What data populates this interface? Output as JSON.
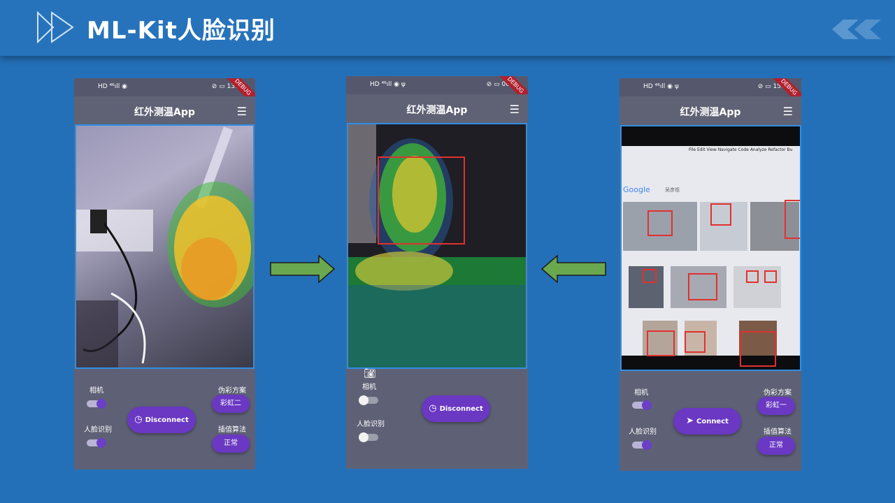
{
  "slide": {
    "title": "ML-Kit人脸识别",
    "accent": "#2470b8"
  },
  "phones": [
    {
      "status_left": "HD ⁴⁶ıll ◉",
      "status_right": "⊘ ▭ 13:",
      "debug": "DEBUG",
      "app_title": "红外测温App",
      "menu_icon": "list-icon",
      "camera_label": "相机",
      "camera_on": true,
      "face_label": "人脸识别",
      "face_on": true,
      "action_label": "Disconnect",
      "action_icon": "clock-icon",
      "pseudo_label": "伪彩方案",
      "pseudo_value": "彩虹二",
      "interp_label": "插值算法",
      "interp_value": "正常"
    },
    {
      "status_left": "HD ⁴⁶ıll ◉ ψ",
      "status_right": "⊘ ▭ 00",
      "debug": "DEBUG",
      "app_title": "红外测温App",
      "menu_icon": "list-icon",
      "camera_label": "相机",
      "camera_on": false,
      "face_label": "人脸识别",
      "face_on": false,
      "action_label": "Disconnect",
      "action_icon": "clock-icon"
    },
    {
      "status_left": "HD ⁴⁶ıll ◉ ψ",
      "status_right": "⊘ ▭ 15:",
      "debug": "DEBUG",
      "app_title": "红外测温App",
      "menu_icon": "list-icon",
      "camera_label": "相机",
      "camera_on": true,
      "face_label": "人脸识别",
      "face_on": true,
      "action_label": "Connect",
      "action_icon": "send-icon",
      "pseudo_label": "伪彩方案",
      "pseudo_value": "彩虹一",
      "interp_label": "插值算法",
      "interp_value": "正常",
      "browser_menu": [
        "File",
        "Edit",
        "View",
        "Navigate",
        "Code",
        "Analyze",
        "Refactor",
        "Bu"
      ],
      "google_logo": "Google",
      "search_text": "吴彦祖"
    }
  ],
  "arrows": {
    "color": "#6aa84f"
  }
}
